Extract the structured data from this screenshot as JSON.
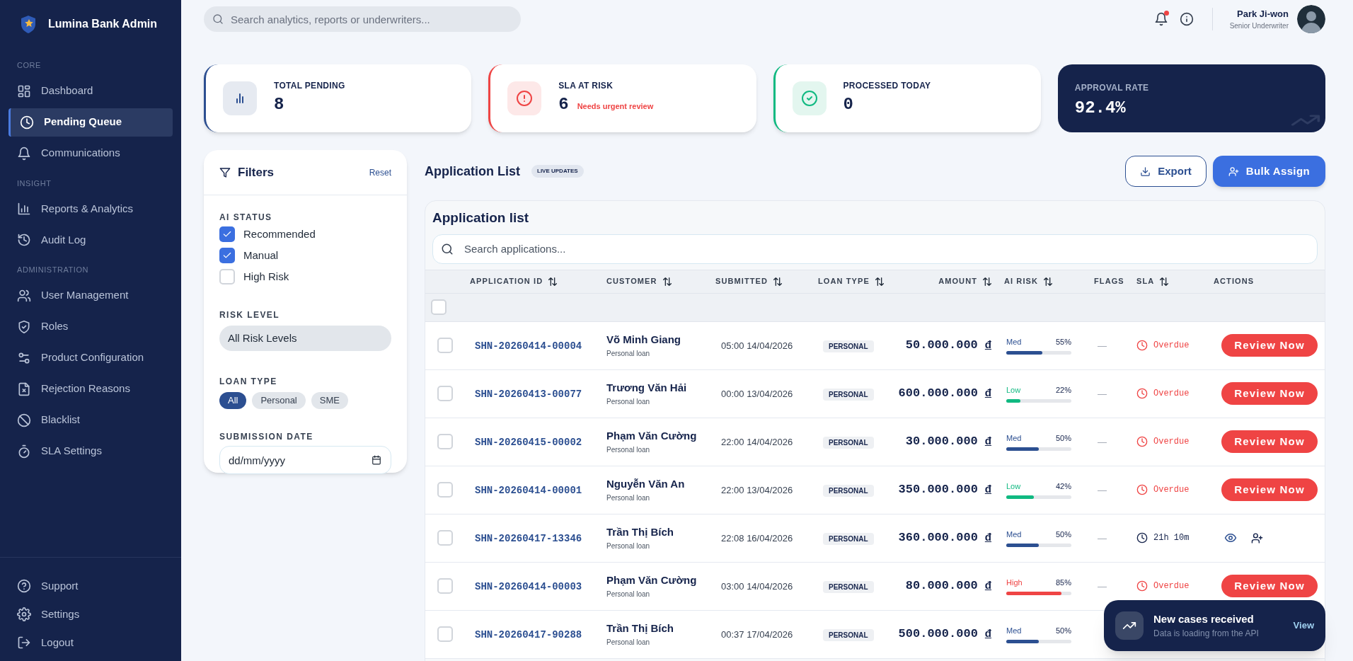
{
  "sidebar": {
    "brand": "Lumina Bank Admin",
    "sections": [
      {
        "label": "CORE",
        "items": [
          {
            "label": "Dashboard",
            "selected": false
          },
          {
            "label": "Pending Queue",
            "selected": true
          },
          {
            "label": "Communications",
            "selected": false
          }
        ]
      },
      {
        "label": "INSIGHT",
        "items": [
          {
            "label": "Reports & Analytics",
            "selected": false
          },
          {
            "label": "Audit Log",
            "selected": false
          }
        ]
      },
      {
        "label": "ADMINISTRATION",
        "items": [
          {
            "label": "User Management",
            "selected": false
          },
          {
            "label": "Roles",
            "selected": false
          },
          {
            "label": "Product Configuration",
            "selected": false
          },
          {
            "label": "Rejection Reasons",
            "selected": false
          },
          {
            "label": "Blacklist",
            "selected": false
          },
          {
            "label": "SLA Settings",
            "selected": false
          }
        ]
      }
    ],
    "footer_items": [
      "Support",
      "Settings",
      "Logout"
    ]
  },
  "header": {
    "search_placeholder": "Search analytics, reports or underwriters...",
    "notifications_unread": true,
    "user": {
      "name": "Park Ji-won",
      "role": "Senior Underwriter"
    }
  },
  "stats": [
    {
      "kind": "pending",
      "label": "TOTAL PENDING",
      "value": "8"
    },
    {
      "kind": "risk",
      "label": "SLA AT RISK",
      "value": "6",
      "note": "Needs urgent review"
    },
    {
      "kind": "processed",
      "label": "PROCESSED TODAY",
      "value": "0"
    },
    {
      "kind": "rate",
      "label": "APPROVAL RATE",
      "value": "92.4%"
    }
  ],
  "filters": {
    "title": "Filters",
    "reset": "Reset",
    "ai_status": {
      "label": "AI STATUS",
      "options": [
        {
          "label": "Recommended",
          "checked": true
        },
        {
          "label": "Manual",
          "checked": true
        },
        {
          "label": "High Risk",
          "checked": false
        }
      ]
    },
    "risk_level": {
      "label": "RISK LEVEL",
      "value": "All Risk Levels"
    },
    "loan_type": {
      "label": "LOAN TYPE",
      "options": [
        {
          "label": "All",
          "selected": true
        },
        {
          "label": "Personal",
          "selected": false
        },
        {
          "label": "SME",
          "selected": false
        }
      ]
    },
    "submission_date": {
      "label": "SUBMISSION DATE",
      "placeholder": "dd/mm/yyyy"
    }
  },
  "list": {
    "title": "Application List",
    "badge": "LIVE UPDATES",
    "export": "Export",
    "bulk_assign": "Bulk Assign",
    "card_title": "Application list",
    "search_placeholder": "Search applications...",
    "columns": [
      {
        "label": "APPLICATION ID",
        "sortable": true
      },
      {
        "label": "CUSTOMER",
        "sortable": true
      },
      {
        "label": "SUBMITTED",
        "sortable": true
      },
      {
        "label": "LOAN TYPE",
        "sortable": true
      },
      {
        "label": "AMOUNT",
        "sortable": true
      },
      {
        "label": "AI RISK",
        "sortable": true
      },
      {
        "label": "FLAGS",
        "sortable": false
      },
      {
        "label": "SLA",
        "sortable": true
      },
      {
        "label": "ACTIONS",
        "sortable": false
      }
    ],
    "select_all": false,
    "rows": [
      {
        "selected": false,
        "id": "SHN-20260414-00004",
        "customer": "Võ Minh Giang",
        "product": "Personal loan",
        "submitted": "05:00 14/04/2026",
        "loan_type": "PERSONAL",
        "amount": "50.000.000",
        "currency": "đ",
        "risk": {
          "kind": "med",
          "label": "Med",
          "percent": "55%",
          "level": 0.55
        },
        "flags": "—",
        "sla": {
          "kind": "overdue",
          "text": "Overdue"
        },
        "action": {
          "kind": "review",
          "label": "Review Now"
        }
      },
      {
        "selected": false,
        "id": "SHN-20260413-00077",
        "customer": "Trương Văn Hải",
        "product": "Personal loan",
        "submitted": "00:00 13/04/2026",
        "loan_type": "PERSONAL",
        "amount": "600.000.000",
        "currency": "đ",
        "risk": {
          "kind": "low",
          "label": "Low",
          "percent": "22%",
          "level": 0.22
        },
        "flags": "—",
        "sla": {
          "kind": "overdue",
          "text": "Overdue"
        },
        "action": {
          "kind": "review",
          "label": "Review Now"
        }
      },
      {
        "selected": false,
        "id": "SHN-20260415-00002",
        "customer": "Phạm Văn Cường",
        "product": "Personal loan",
        "submitted": "22:00 14/04/2026",
        "loan_type": "PERSONAL",
        "amount": "30.000.000",
        "currency": "đ",
        "risk": {
          "kind": "med",
          "label": "Med",
          "percent": "50%",
          "level": 0.5
        },
        "flags": "—",
        "sla": {
          "kind": "overdue",
          "text": "Overdue"
        },
        "action": {
          "kind": "review",
          "label": "Review Now"
        }
      },
      {
        "selected": false,
        "id": "SHN-20260414-00001",
        "customer": "Nguyễn Văn An",
        "product": "Personal loan",
        "submitted": "22:00 13/04/2026",
        "loan_type": "PERSONAL",
        "amount": "350.000.000",
        "currency": "đ",
        "risk": {
          "kind": "low",
          "label": "Low",
          "percent": "42%",
          "level": 0.42
        },
        "flags": "—",
        "sla": {
          "kind": "overdue",
          "text": "Overdue"
        },
        "action": {
          "kind": "review",
          "label": "Review Now"
        }
      },
      {
        "selected": false,
        "id": "SHN-20260417-13346",
        "customer": "Trần Thị Bích",
        "product": "Personal loan",
        "submitted": "22:08 16/04/2026",
        "loan_type": "PERSONAL",
        "amount": "360.000.000",
        "currency": "đ",
        "risk": {
          "kind": "med",
          "label": "Med",
          "percent": "50%",
          "level": 0.5
        },
        "flags": "—",
        "sla": {
          "kind": "timer",
          "text": "21h 10m"
        },
        "action": {
          "kind": "icons"
        }
      },
      {
        "selected": false,
        "id": "SHN-20260414-00003",
        "customer": "Phạm Văn Cường",
        "product": "Personal loan",
        "submitted": "03:00 14/04/2026",
        "loan_type": "PERSONAL",
        "amount": "80.000.000",
        "currency": "đ",
        "risk": {
          "kind": "high",
          "label": "High",
          "percent": "85%",
          "level": 0.85
        },
        "flags": "—",
        "sla": {
          "kind": "overdue",
          "text": "Overdue"
        },
        "action": {
          "kind": "review",
          "label": "Review Now"
        }
      },
      {
        "selected": false,
        "id": "SHN-20260417-90288",
        "customer": "Trần Thị Bích",
        "product": "Personal loan",
        "submitted": "00:37 17/04/2026",
        "loan_type": "PERSONAL",
        "amount": "500.000.000",
        "currency": "đ",
        "risk": {
          "kind": "med",
          "label": "Med",
          "percent": "50%",
          "level": 0.5
        }
      }
    ]
  },
  "toast": {
    "title": "New cases received",
    "message": "Data is loading from the API",
    "action": "View"
  }
}
